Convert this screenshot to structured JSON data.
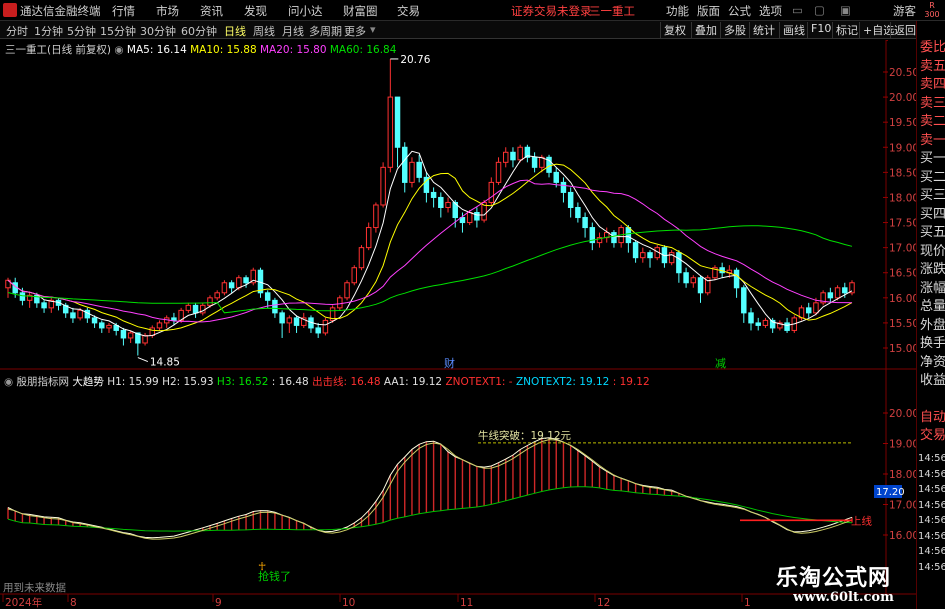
{
  "menubar": {
    "app_title": "通达信金融终端",
    "items": [
      "行情",
      "市场",
      "资讯",
      "发现",
      "问小达",
      "财富圈",
      "交易"
    ],
    "status": "证券交易未登录",
    "stock": "三一重工",
    "right_items": [
      "功能",
      "版面",
      "公式",
      "选项"
    ],
    "guest": "游客"
  },
  "toolbar": {
    "periods": [
      "分时",
      "1分钟",
      "5分钟",
      "15分钟",
      "30分钟",
      "60分钟",
      "日线",
      "周线",
      "月线",
      "多周期",
      "更多"
    ],
    "active": "日线",
    "right_buttons": [
      "复权",
      "叠加",
      "多股",
      "统计",
      "画线",
      "F10",
      "标记",
      "+自选",
      "返回"
    ]
  },
  "main_legend": {
    "title": "三一重工(日线 前复权)",
    "ma": [
      {
        "label": "MA5: 16.14",
        "color": "#ffffff"
      },
      {
        "label": "MA10: 15.88",
        "color": "#ffff00"
      },
      {
        "label": "MA20: 15.80",
        "color": "#ff40ff"
      },
      {
        "label": "MA60: 16.84",
        "color": "#00e000"
      }
    ]
  },
  "sub_legend": {
    "title": "殷朋指标网",
    "name": "大趋势",
    "items": [
      {
        "label": "H1: 15.99",
        "color": "#e0e0e0"
      },
      {
        "label": "H2: 15.93",
        "color": "#e0e0e0"
      },
      {
        "label": "H3: 16.52",
        "color": "#00e000"
      },
      {
        "label": ": 16.48",
        "color": "#e0e0e0"
      },
      {
        "label": "出击线: 16.48",
        "color": "#ff3030"
      },
      {
        "label": "AA1: 19.12",
        "color": "#e0e0e0"
      },
      {
        "label": "ZNOTEXT1: -",
        "color": "#ff3030"
      },
      {
        "label": "ZNOTEXT2: 19.12",
        "color": "#00d8ff"
      },
      {
        "label": ": 19.12",
        "color": "#ff3030"
      }
    ]
  },
  "right_panel": {
    "top_badge": [
      "R",
      "300"
    ],
    "labels": [
      "委比",
      "卖五",
      "卖四",
      "卖三",
      "卖二",
      "卖一",
      "买一",
      "买二",
      "买三",
      "买四",
      "买五",
      "现价",
      "涨跌",
      "涨幅",
      "总量",
      "外盘",
      "换手",
      "净资",
      "收益",
      "自动",
      "交易"
    ],
    "times": [
      "14:56",
      "14:56",
      "14:56",
      "14:56",
      "14:56",
      "14:56",
      "14:56",
      "14:56"
    ]
  },
  "annotations": {
    "high": "20.76",
    "low": "14.85",
    "cai": "财",
    "jian": "减",
    "niu_line": "牛线突破：19.12元",
    "shang": "上线",
    "ke": "抢钱了",
    "value_box": "17.20"
  },
  "footer": {
    "note": "用到未来数据",
    "dates": [
      "2024年",
      "8",
      "9",
      "10",
      "11",
      "12",
      "1"
    ]
  },
  "watermark": {
    "line1": "乐淘公式网",
    "line2": "www.60lt.com"
  },
  "chart_data": {
    "type": "candlestick",
    "main_y_ticks": [
      20.5,
      20.0,
      19.5,
      19.0,
      18.5,
      18.0,
      17.5,
      17.0,
      16.5,
      16.0,
      15.5,
      15.0
    ],
    "sub_y_ticks": [
      20.0,
      19.0,
      18.0,
      17.0,
      16.0
    ],
    "high": 20.76,
    "low": 14.85,
    "bars": [
      [
        16.2,
        16.35,
        16.0,
        16.4
      ],
      [
        16.3,
        16.1,
        16.0,
        16.4
      ],
      [
        16.1,
        15.95,
        15.85,
        16.2
      ],
      [
        15.95,
        16.05,
        15.8,
        16.1
      ],
      [
        16.05,
        15.9,
        15.8,
        16.1
      ],
      [
        15.9,
        15.8,
        15.7,
        15.95
      ],
      [
        15.8,
        15.95,
        15.7,
        16.0
      ],
      [
        15.95,
        15.85,
        15.75,
        16.0
      ],
      [
        15.85,
        15.7,
        15.6,
        15.9
      ],
      [
        15.7,
        15.6,
        15.5,
        15.8
      ],
      [
        15.6,
        15.75,
        15.55,
        15.8
      ],
      [
        15.75,
        15.6,
        15.5,
        15.8
      ],
      [
        15.6,
        15.5,
        15.4,
        15.65
      ],
      [
        15.5,
        15.4,
        15.3,
        15.55
      ],
      [
        15.4,
        15.45,
        15.3,
        15.5
      ],
      [
        15.45,
        15.35,
        15.25,
        15.5
      ],
      [
        15.35,
        15.2,
        15.05,
        15.4
      ],
      [
        15.2,
        15.3,
        15.1,
        15.35
      ],
      [
        15.3,
        15.1,
        14.85,
        15.3
      ],
      [
        15.1,
        15.25,
        15.05,
        15.3
      ],
      [
        15.25,
        15.4,
        15.2,
        15.45
      ],
      [
        15.4,
        15.5,
        15.35,
        15.55
      ],
      [
        15.5,
        15.6,
        15.4,
        15.65
      ],
      [
        15.6,
        15.55,
        15.45,
        15.7
      ],
      [
        15.55,
        15.75,
        15.5,
        15.8
      ],
      [
        15.75,
        15.85,
        15.7,
        15.9
      ],
      [
        15.85,
        15.7,
        15.6,
        15.9
      ],
      [
        15.7,
        15.85,
        15.65,
        15.9
      ],
      [
        15.85,
        16.0,
        15.8,
        16.05
      ],
      [
        16.0,
        16.1,
        15.95,
        16.15
      ],
      [
        16.1,
        16.3,
        16.05,
        16.35
      ],
      [
        16.3,
        16.2,
        16.1,
        16.35
      ],
      [
        16.2,
        16.4,
        16.15,
        16.45
      ],
      [
        16.4,
        16.3,
        16.2,
        16.45
      ],
      [
        16.3,
        16.55,
        16.25,
        16.6
      ],
      [
        16.55,
        16.1,
        16.0,
        16.6
      ],
      [
        16.1,
        15.95,
        15.8,
        16.15
      ],
      [
        15.95,
        15.7,
        15.6,
        16.0
      ],
      [
        15.7,
        15.5,
        15.2,
        15.75
      ],
      [
        15.5,
        15.6,
        15.3,
        15.65
      ],
      [
        15.6,
        15.45,
        15.3,
        15.65
      ],
      [
        15.45,
        15.6,
        15.4,
        15.7
      ],
      [
        15.6,
        15.4,
        15.3,
        15.65
      ],
      [
        15.4,
        15.3,
        15.2,
        15.5
      ],
      [
        15.3,
        15.55,
        15.25,
        15.6
      ],
      [
        15.55,
        15.8,
        15.5,
        15.85
      ],
      [
        15.8,
        16.0,
        15.75,
        16.05
      ],
      [
        16.0,
        16.3,
        15.95,
        16.35
      ],
      [
        16.3,
        16.6,
        16.25,
        16.65
      ],
      [
        16.6,
        17.0,
        16.55,
        17.05
      ],
      [
        17.0,
        17.4,
        16.95,
        17.5
      ],
      [
        17.4,
        17.85,
        17.3,
        17.9
      ],
      [
        17.85,
        18.6,
        17.8,
        18.7
      ],
      [
        18.6,
        20.0,
        18.5,
        20.76
      ],
      [
        20.0,
        19.0,
        18.6,
        20.0
      ],
      [
        19.0,
        18.3,
        18.1,
        19.1
      ],
      [
        18.3,
        18.7,
        18.2,
        18.8
      ],
      [
        18.7,
        18.4,
        18.3,
        18.85
      ],
      [
        18.4,
        18.1,
        17.9,
        18.5
      ],
      [
        18.1,
        18.0,
        17.8,
        18.2
      ],
      [
        18.0,
        17.8,
        17.6,
        18.1
      ],
      [
        17.8,
        17.9,
        17.7,
        18.0
      ],
      [
        17.9,
        17.6,
        17.4,
        17.95
      ],
      [
        17.6,
        17.5,
        17.3,
        17.7
      ],
      [
        17.5,
        17.7,
        17.45,
        17.75
      ],
      [
        17.7,
        17.55,
        17.4,
        17.8
      ],
      [
        17.55,
        17.9,
        17.5,
        17.95
      ],
      [
        17.9,
        18.3,
        17.85,
        18.4
      ],
      [
        18.3,
        18.7,
        18.25,
        18.8
      ],
      [
        18.7,
        18.9,
        18.6,
        19.0
      ],
      [
        18.9,
        18.75,
        18.6,
        19.0
      ],
      [
        18.75,
        19.0,
        18.7,
        19.05
      ],
      [
        19.0,
        18.8,
        18.7,
        19.05
      ],
      [
        18.8,
        18.6,
        18.5,
        18.9
      ],
      [
        18.6,
        18.8,
        18.5,
        18.85
      ],
      [
        18.8,
        18.5,
        18.4,
        18.85
      ],
      [
        18.5,
        18.3,
        18.2,
        18.6
      ],
      [
        18.3,
        18.1,
        17.9,
        18.4
      ],
      [
        18.1,
        17.8,
        17.6,
        18.2
      ],
      [
        17.8,
        17.6,
        17.5,
        17.9
      ],
      [
        17.6,
        17.4,
        17.2,
        17.7
      ],
      [
        17.4,
        17.1,
        16.95,
        17.5
      ],
      [
        17.1,
        17.2,
        17.0,
        17.3
      ],
      [
        17.2,
        17.3,
        17.1,
        17.4
      ],
      [
        17.3,
        17.1,
        17.0,
        17.35
      ],
      [
        17.1,
        17.4,
        17.0,
        17.45
      ],
      [
        17.4,
        17.1,
        16.9,
        17.45
      ],
      [
        17.1,
        16.8,
        16.7,
        17.15
      ],
      [
        16.8,
        16.9,
        16.7,
        17.0
      ],
      [
        16.9,
        16.8,
        16.6,
        16.95
      ],
      [
        16.8,
        17.0,
        16.75,
        17.05
      ],
      [
        17.0,
        16.7,
        16.6,
        17.05
      ],
      [
        16.7,
        16.9,
        16.65,
        16.95
      ],
      [
        16.9,
        16.5,
        16.3,
        16.95
      ],
      [
        16.5,
        16.3,
        16.2,
        16.6
      ],
      [
        16.3,
        16.4,
        16.2,
        16.45
      ],
      [
        16.4,
        16.1,
        15.9,
        16.45
      ],
      [
        16.1,
        16.4,
        16.05,
        16.45
      ],
      [
        16.4,
        16.6,
        16.35,
        16.65
      ],
      [
        16.6,
        16.5,
        16.4,
        16.7
      ],
      [
        16.5,
        16.55,
        16.4,
        16.65
      ],
      [
        16.55,
        16.2,
        16.0,
        16.6
      ],
      [
        16.2,
        15.7,
        15.5,
        16.25
      ],
      [
        15.7,
        15.5,
        15.35,
        15.8
      ],
      [
        15.5,
        15.45,
        15.35,
        15.6
      ],
      [
        15.45,
        15.55,
        15.4,
        15.6
      ],
      [
        15.55,
        15.4,
        15.3,
        15.6
      ],
      [
        15.4,
        15.5,
        15.35,
        15.55
      ],
      [
        15.5,
        15.35,
        15.3,
        15.6
      ],
      [
        15.35,
        15.6,
        15.3,
        15.65
      ],
      [
        15.6,
        15.8,
        15.55,
        15.85
      ],
      [
        15.8,
        15.7,
        15.6,
        15.9
      ],
      [
        15.7,
        15.9,
        15.65,
        16.0
      ],
      [
        15.9,
        16.1,
        15.85,
        16.15
      ],
      [
        16.1,
        16.0,
        15.9,
        16.2
      ],
      [
        16.0,
        16.2,
        15.95,
        16.25
      ],
      [
        16.2,
        16.1,
        16.0,
        16.3
      ],
      [
        16.1,
        16.3,
        16.05,
        16.35
      ]
    ]
  }
}
